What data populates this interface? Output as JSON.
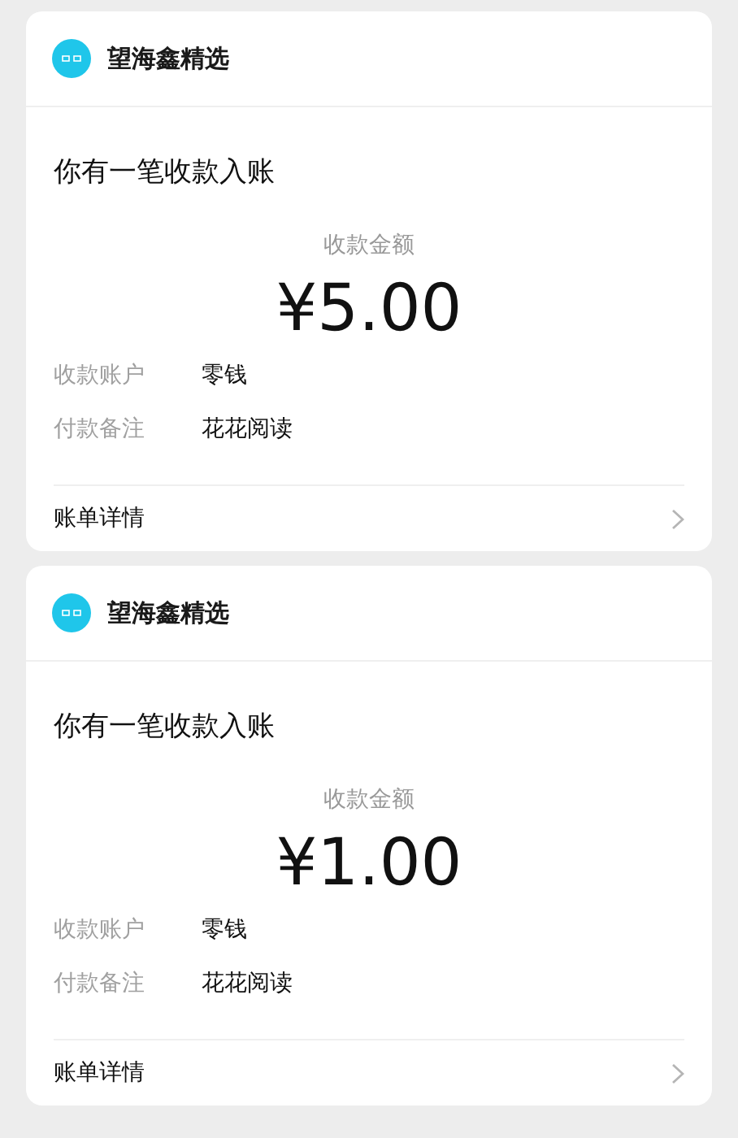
{
  "messages": [
    {
      "merchant": "望海鑫精选",
      "title": "你有一笔收款入账",
      "amount_label": "收款金额",
      "amount": "¥5.00",
      "fields": [
        {
          "label": "收款账户",
          "value": "零钱"
        },
        {
          "label": "付款备注",
          "value": "花花阅读"
        }
      ],
      "details_link": "账单详情"
    },
    {
      "merchant": "望海鑫精选",
      "title": "你有一笔收款入账",
      "amount_label": "收款金额",
      "amount": "¥1.00",
      "fields": [
        {
          "label": "收款账户",
          "value": "零钱"
        },
        {
          "label": "付款备注",
          "value": "花花阅读"
        }
      ],
      "details_link": "账单详情"
    }
  ]
}
